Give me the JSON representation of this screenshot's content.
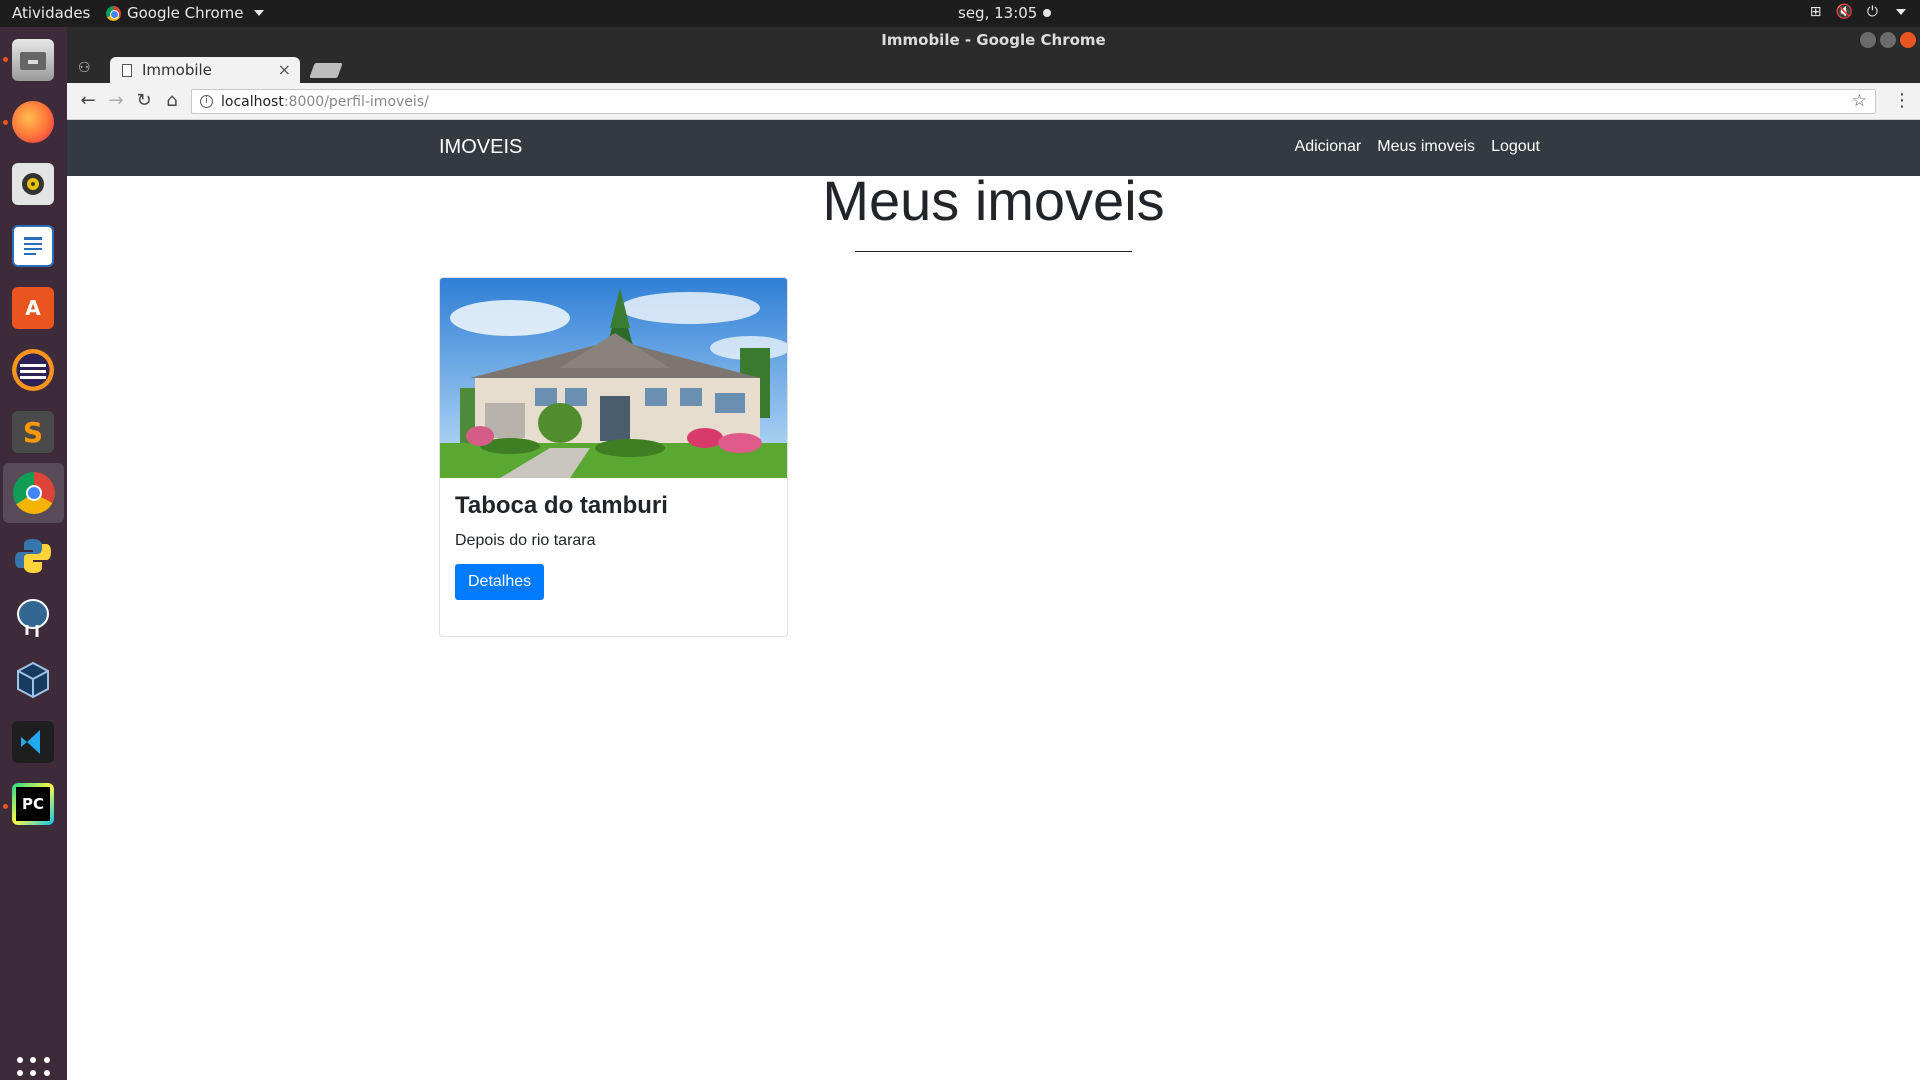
{
  "system_bar": {
    "activities": "Atividades",
    "app_name": "Google Chrome",
    "clock": "seg, 13:05"
  },
  "dock": {
    "apps": [
      "file-manager",
      "firefox",
      "rhythmbox",
      "libreoffice-writer",
      "ubuntu-software",
      "eclipse",
      "sublime-text",
      "google-chrome",
      "python",
      "postgresql",
      "virtualbox",
      "vscode",
      "pycharm"
    ]
  },
  "window": {
    "title": "Immobile - Google Chrome"
  },
  "tab": {
    "title": "Immobile"
  },
  "address_bar": {
    "host": "localhost",
    "path": ":8000/perfil-imoveis/"
  },
  "navbar": {
    "brand": "IMOVEIS",
    "links": [
      "Adicionar",
      "Meus imoveis",
      "Logout"
    ]
  },
  "page": {
    "title": "Meus imoveis"
  },
  "cards": [
    {
      "title": "Taboca do tamburi",
      "description": "Depois do rio tarara",
      "button": "Detalhes"
    }
  ]
}
